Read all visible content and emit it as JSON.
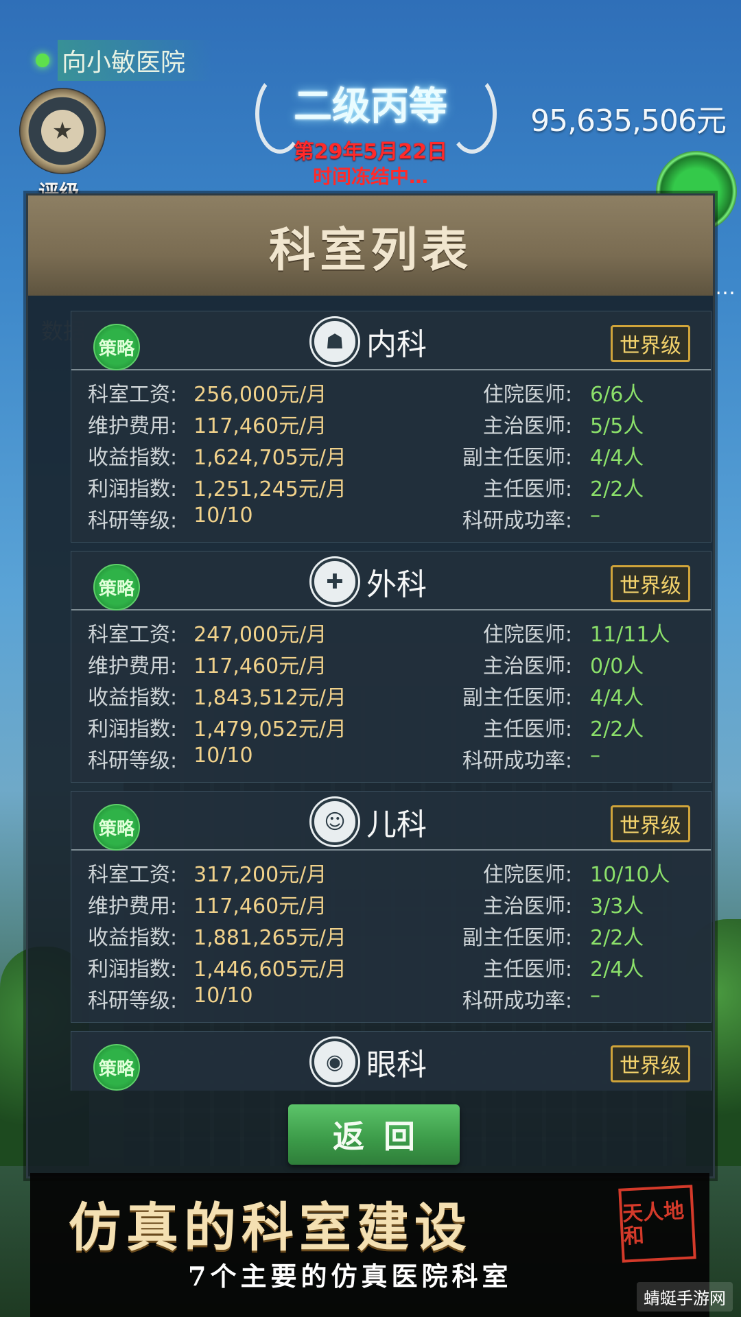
{
  "hud": {
    "hospital_name": "向小敏医院",
    "rating_label": "评级",
    "grade": "二级丙等",
    "date": "第29年5月22日",
    "time_status": "时间冻结中…",
    "money": "95,635,506元",
    "data_label": "数据",
    "more": "…"
  },
  "panel": {
    "title": "科室列表"
  },
  "labels": {
    "strategy": "策略",
    "salary": "科室工资:",
    "maintenance": "维护费用:",
    "revenue": "收益指数:",
    "profit": "利润指数:",
    "research": "科研等级:",
    "resident": "住院医师:",
    "attending": "主治医师:",
    "associate": "副主任医师:",
    "chief": "主任医师:",
    "success_rate": "科研成功率:"
  },
  "departments": [
    {
      "name": "内科",
      "icon": "internal-medicine-icon",
      "level": "世界级",
      "salary": "256,000元/月",
      "maintenance": "117,460元/月",
      "revenue": "1,624,705元/月",
      "profit": "1,251,245元/月",
      "research": "10/10",
      "resident": "6/6人",
      "attending": "5/5人",
      "associate": "4/4人",
      "chief": "2/2人",
      "success_rate": "–"
    },
    {
      "name": "外科",
      "icon": "surgery-icon",
      "level": "世界级",
      "salary": "247,000元/月",
      "maintenance": "117,460元/月",
      "revenue": "1,843,512元/月",
      "profit": "1,479,052元/月",
      "research": "10/10",
      "resident": "11/11人",
      "attending": "0/0人",
      "associate": "4/4人",
      "chief": "2/2人",
      "success_rate": "–"
    },
    {
      "name": "儿科",
      "icon": "pediatrics-icon",
      "level": "世界级",
      "salary": "317,200元/月",
      "maintenance": "117,460元/月",
      "revenue": "1,881,265元/月",
      "profit": "1,446,605元/月",
      "research": "10/10",
      "resident": "10/10人",
      "attending": "3/3人",
      "associate": "2/2人",
      "chief": "2/4人",
      "success_rate": "–"
    },
    {
      "name": "眼科",
      "icon": "ophthalmology-icon",
      "level": "世界级"
    }
  ],
  "back_button": "返回",
  "promo": {
    "title": "仿真的科室建设",
    "subtitle": "7个主要的仿真医院科室",
    "seal": "天人地和"
  },
  "watermark": "蜻蜓手游网",
  "colors": {
    "accent_green": "#2fb248",
    "value_yellow": "#f1d28b",
    "value_green": "#8be06a",
    "alert_red": "#ff2a2a",
    "badge_gold": "#d0a43a"
  }
}
